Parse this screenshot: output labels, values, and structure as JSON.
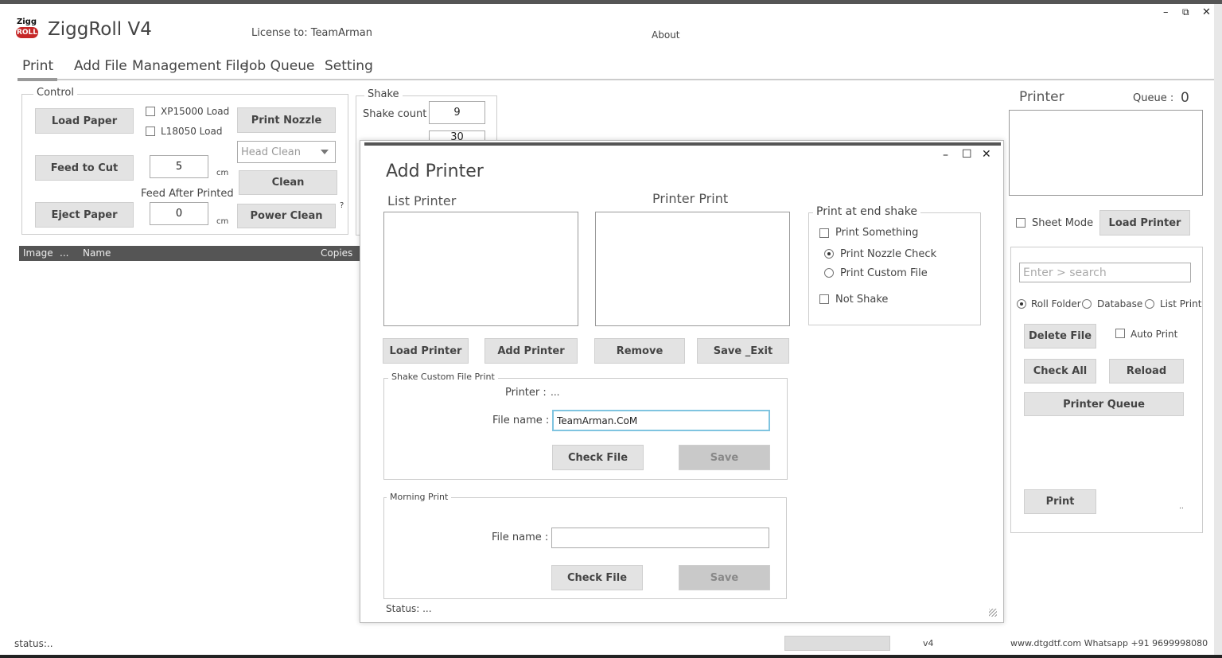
{
  "app": {
    "logo_top": "Zigg",
    "logo_badge": "ROLL",
    "title": "ZiggRoll V4",
    "license": "License to: TeamArman",
    "about": "About",
    "min": "–",
    "restore": "⧉",
    "close": "✕"
  },
  "menu": [
    "Print",
    "Add File",
    "Management File",
    "Job Queue",
    "Setting"
  ],
  "control": {
    "legend": "Control",
    "load_paper": "Load Paper",
    "xp_load": "XP15000 Load",
    "l_load": "L18050 Load",
    "print_nozzle": "Print Nozzle",
    "head_clean": "Head Clean",
    "feed_to_cut": "Feed to Cut",
    "feed_value": "5",
    "cm1": "cm",
    "clean": "Clean",
    "feed_after": "Feed After Printed",
    "eject_paper": "Eject Paper",
    "eject_value": "0",
    "cm2": "cm",
    "power_clean": "Power Clean",
    "q": "?"
  },
  "shake": {
    "legend": "Shake",
    "count_label": "Shake count",
    "count_value": "9",
    "hidden_value": "30"
  },
  "table": {
    "col_image": "Image",
    "col_dots": "...",
    "col_name": "Name",
    "col_copies": "Copies"
  },
  "printer_panel": {
    "title": "Printer",
    "queue_label": "Queue :",
    "queue_value": "0",
    "sheet_mode": "Sheet Mode",
    "load_printer": "Load Printer",
    "search_placeholder": "Enter > search",
    "roll_folder": "Roll Folder",
    "database": "Database",
    "list_print": "List Print",
    "delete_file": "Delete File",
    "auto_print": "Auto Print",
    "check_all": "Check All",
    "reload": "Reload",
    "printer_queue": "Printer Queue",
    "print": "Print",
    "dots": ".."
  },
  "dialog": {
    "title": "Add Printer",
    "min": "–",
    "max": "☐",
    "close": "✕",
    "list_printer": "List Printer",
    "printer_print": "Printer Print",
    "end_shake_legend": "Print at end shake",
    "print_something": "Print Something",
    "print_nozzle_check": "Print Nozzle Check",
    "print_custom_file": "Print Custom File",
    "not_shake": "Not Shake",
    "load_printer": "Load Printer",
    "add_printer": "Add Printer",
    "remove": "Remove",
    "save_exit": "Save _Exit",
    "scf_legend": "Shake Custom File Print",
    "printer_label": "Printer :",
    "printer_value": "...",
    "file_name_label": "File name :",
    "file_name_value": "TeamArman.CoM",
    "check_file": "Check File",
    "save": "Save",
    "morning_legend": "Morning Print",
    "file_name_label2": "File name :",
    "file_name_value2": "",
    "check_file2": "Check File",
    "save2": "Save",
    "status": "Status: ..."
  },
  "statusbar": {
    "status": "status:..",
    "version": "v4",
    "contact": "www.dtgdtf.com Whatsapp +91 9699998080"
  }
}
